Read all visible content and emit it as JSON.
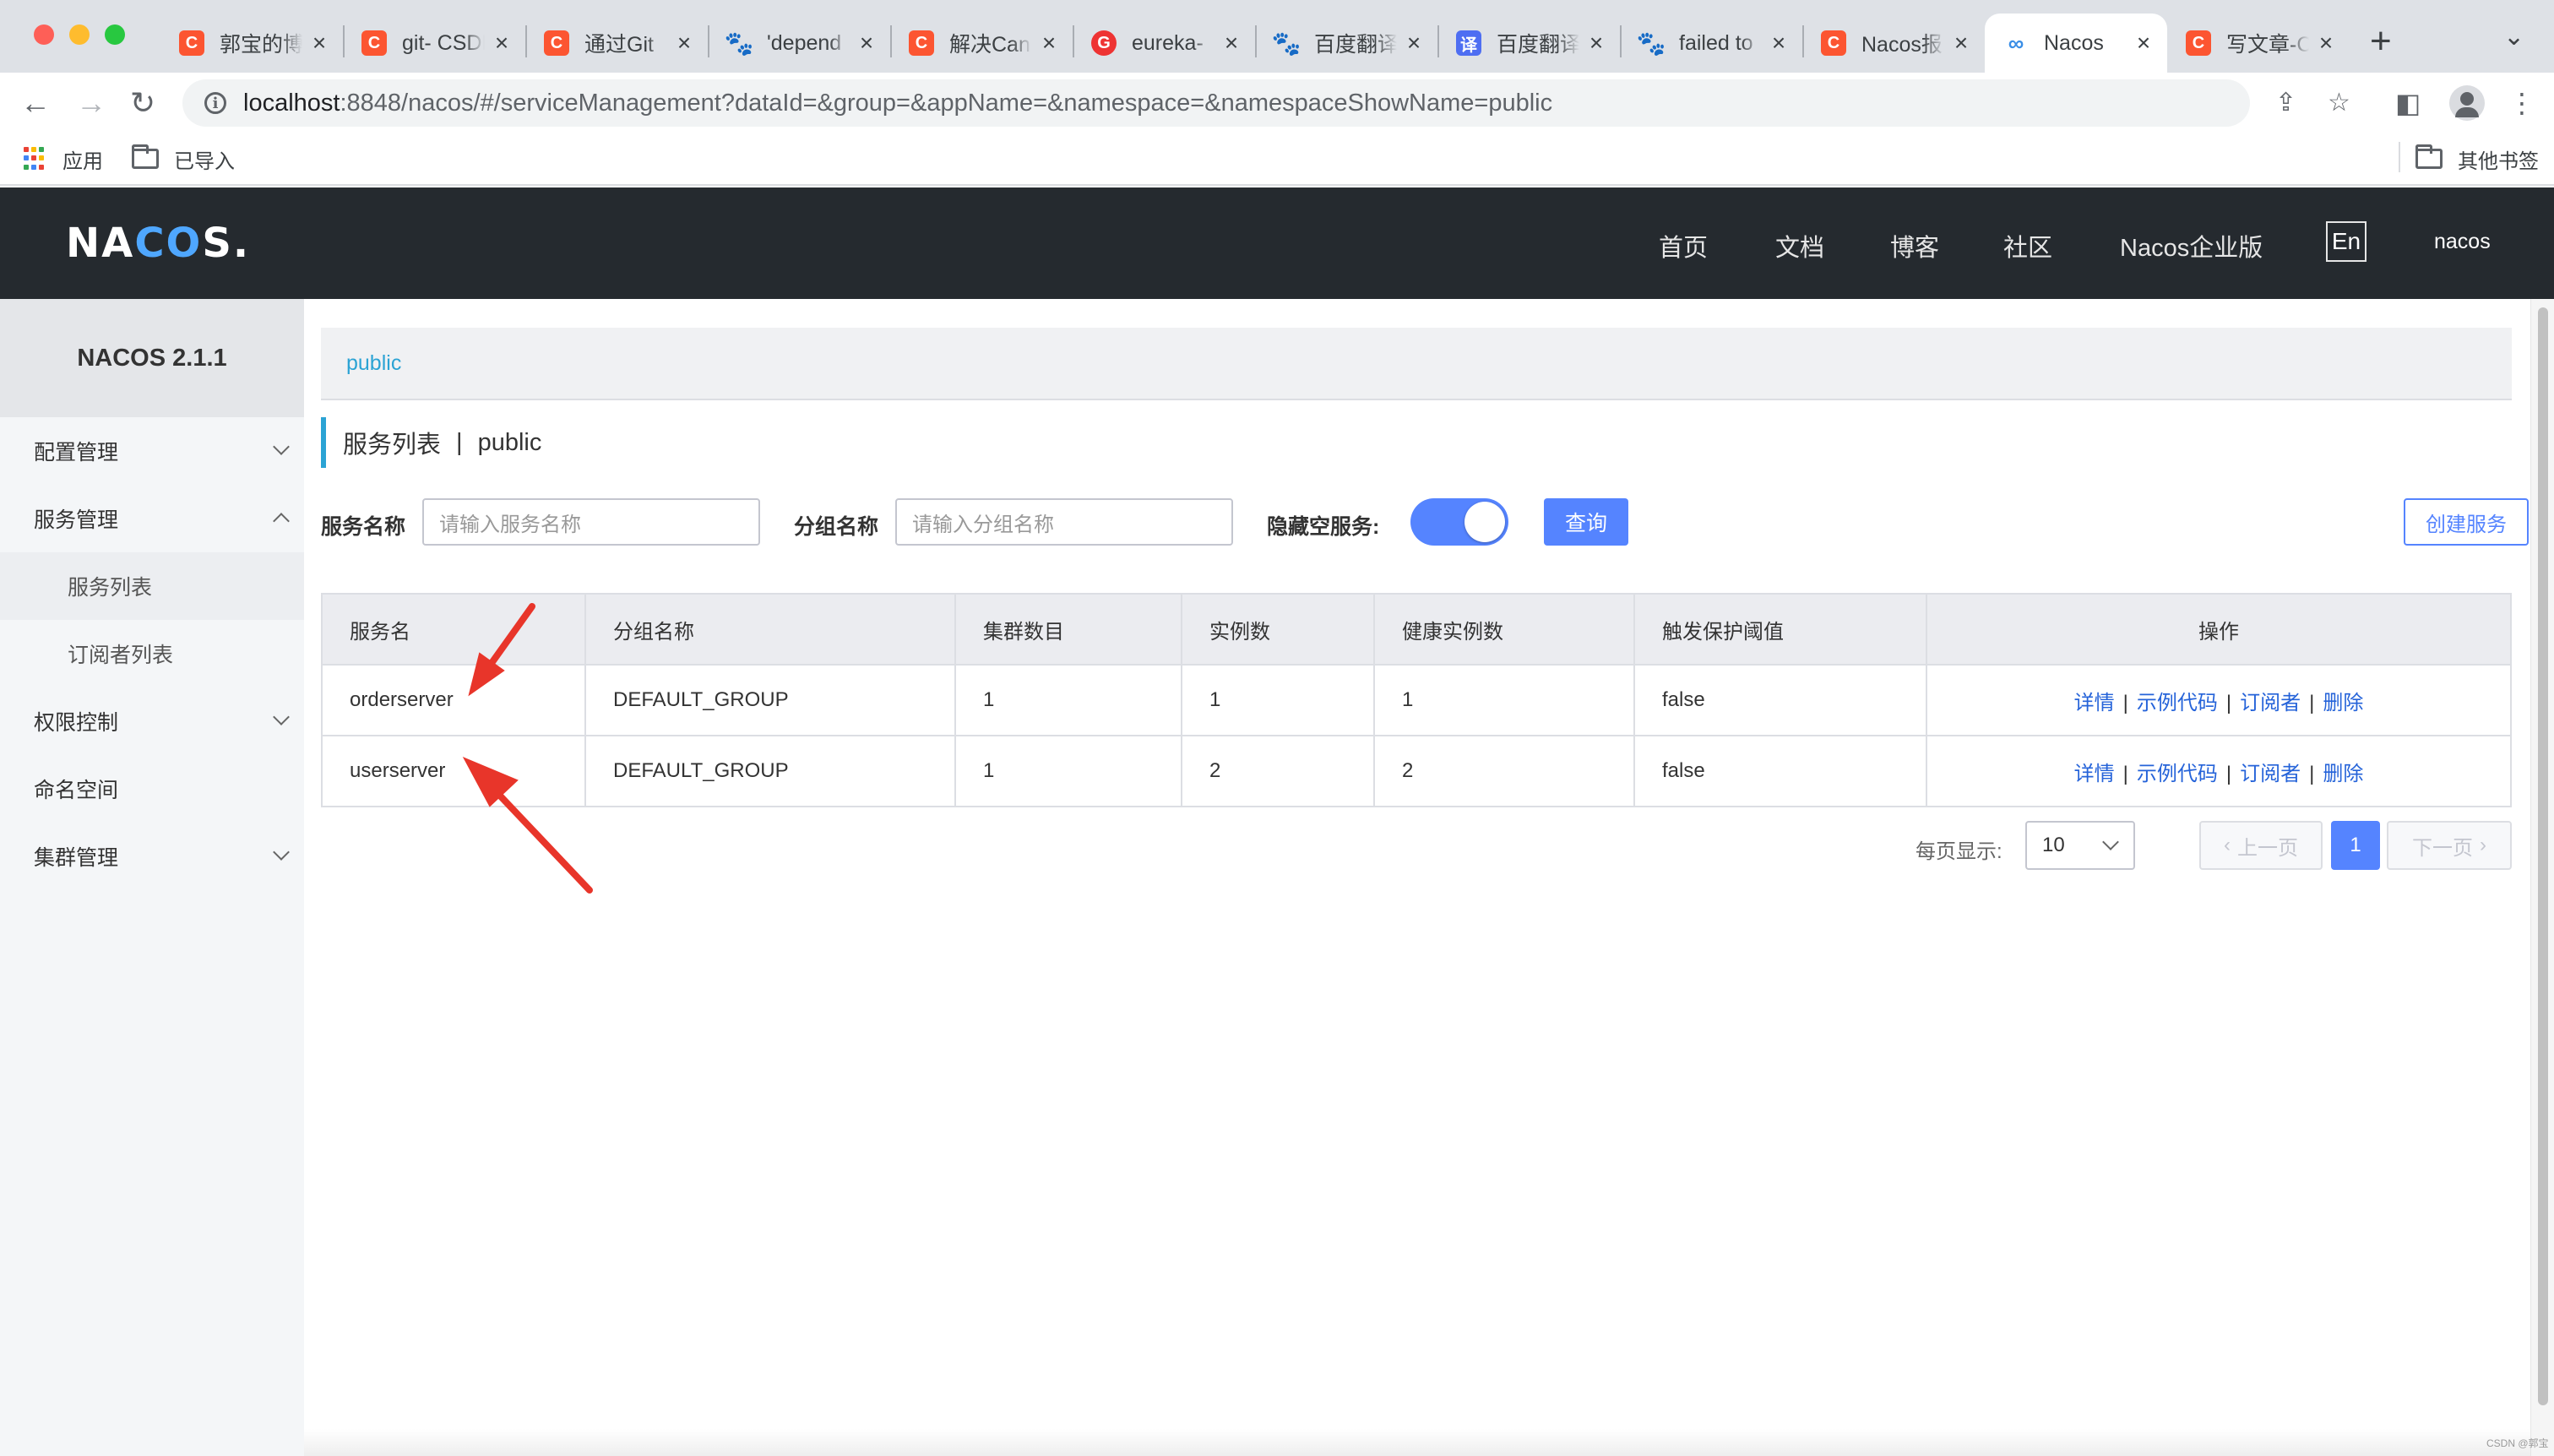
{
  "browser": {
    "tabs": [
      {
        "title": "郭宝的博",
        "icon": "csdn-icon",
        "glyph": "C"
      },
      {
        "title": "git- CSDN",
        "icon": "csdn-icon",
        "glyph": "C"
      },
      {
        "title": "通过Git",
        "icon": "csdn-icon",
        "glyph": "C"
      },
      {
        "title": "'depend",
        "icon": "baidu-paw-icon",
        "glyph": "🐾"
      },
      {
        "title": "解决Can",
        "icon": "csdn-icon",
        "glyph": "C"
      },
      {
        "title": "eureka-",
        "icon": "eureka-icon",
        "glyph": "G"
      },
      {
        "title": "百度翻译",
        "icon": "baidu-paw-icon",
        "glyph": "🐾"
      },
      {
        "title": "百度翻译",
        "icon": "baidu-translate-icon",
        "glyph": "译"
      },
      {
        "title": "failed to",
        "icon": "baidu-paw-icon",
        "glyph": "🐾"
      },
      {
        "title": "Nacos报",
        "icon": "csdn-icon",
        "glyph": "C"
      },
      {
        "title": "Nacos",
        "icon": "nacos-icon",
        "glyph": "∞"
      },
      {
        "title": "写文章-C",
        "icon": "csdn-icon",
        "glyph": "C"
      }
    ],
    "new_tab_glyph": "+",
    "url_host": "localhost",
    "url_rest": ":8848/nacos/#/serviceManagement?dataId=&group=&appName=&namespace=&namespaceShowName=public",
    "bookmarks": {
      "apps": "应用",
      "imported": "已导入",
      "other": "其他书签"
    }
  },
  "header": {
    "logo_left": "NA",
    "logo_co": "CO",
    "logo_right": "S.",
    "nav": [
      "首页",
      "文档",
      "博客",
      "社区",
      "Nacos企业版"
    ],
    "lang": "En",
    "user": "nacos"
  },
  "sidebar": {
    "title": "NACOS 2.1.1",
    "items": [
      {
        "label": "配置管理"
      },
      {
        "label": "服务管理"
      },
      {
        "label": "服务列表"
      },
      {
        "label": "订阅者列表"
      },
      {
        "label": "权限控制"
      },
      {
        "label": "命名空间"
      },
      {
        "label": "集群管理"
      }
    ]
  },
  "main": {
    "namespace": "public",
    "page_title": "服务列表",
    "title_sep": "|",
    "title_ns": "public",
    "filters": {
      "service_label": "服务名称",
      "service_placeholder": "请输入服务名称",
      "group_label": "分组名称",
      "group_placeholder": "请输入分组名称",
      "hide_empty_label": "隐藏空服务:",
      "hide_empty_on": true,
      "query_button": "查询",
      "create_button": "创建服务"
    },
    "table": {
      "columns": [
        "服务名",
        "分组名称",
        "集群数目",
        "实例数",
        "健康实例数",
        "触发保护阈值",
        "操作"
      ],
      "rows": [
        {
          "name": "orderserver",
          "group": "DEFAULT_GROUP",
          "clusters": "1",
          "instances": "1",
          "healthy": "1",
          "threshold": "false"
        },
        {
          "name": "userserver",
          "group": "DEFAULT_GROUP",
          "clusters": "1",
          "instances": "2",
          "healthy": "2",
          "threshold": "false"
        }
      ],
      "ops": {
        "detail": "详情",
        "sample": "示例代码",
        "subscriber": "订阅者",
        "delete": "删除",
        "sep": "|"
      }
    },
    "pagination": {
      "per_page_label": "每页显示:",
      "per_page": "10",
      "prev": "上一页",
      "next": "下一页",
      "current": "1"
    }
  },
  "watermark": "CSDN @郭宝",
  "colors": {
    "accent": "#5584ff",
    "link": "#2563d9",
    "header_bg": "#252a2f",
    "annotation": "#e8352a"
  }
}
